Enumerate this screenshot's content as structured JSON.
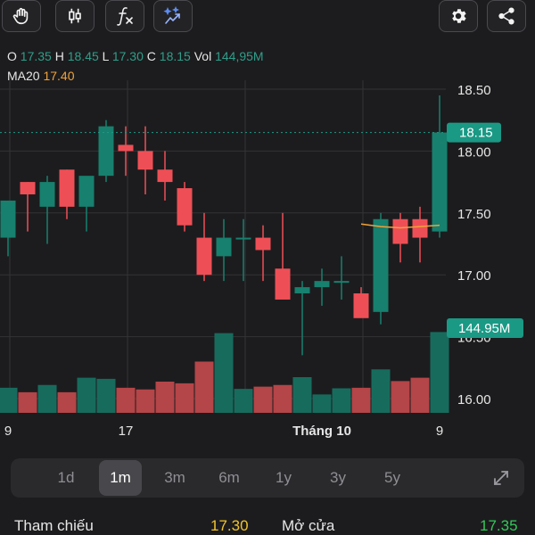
{
  "toolbar": {
    "left_icons": [
      "hand-icon",
      "candlestick-icon",
      "function-icon",
      "magic-icon"
    ],
    "right_icons": [
      "gear-icon",
      "share-icon"
    ]
  },
  "ohlc": {
    "open_label": "O",
    "open": "17.35",
    "high_label": "H",
    "high": "18.45",
    "low_label": "L",
    "low": "17.30",
    "close_label": "C",
    "close": "18.15",
    "vol_label": "Vol",
    "vol": "144,95M"
  },
  "ma": {
    "label": "MA20",
    "value": "17.40"
  },
  "colors": {
    "up": "#17806e",
    "down": "#ee4f56",
    "vol_up": "#176b5d",
    "vol_down": "#b44548",
    "ma": "#f0a23a",
    "grid": "#333336",
    "background": "#1c1c1e"
  },
  "chart_data": {
    "type": "candlestick",
    "y_ticks": [
      "18.50",
      "18.00",
      "17.50",
      "17.00",
      "16.50",
      "16.00"
    ],
    "ylim": [
      16.0,
      18.5
    ],
    "x_tick_labels": [
      {
        "index": 0,
        "label": "9"
      },
      {
        "index": 6,
        "label": "17"
      },
      {
        "index": 16,
        "label": "Tháng 10"
      },
      {
        "index": 22,
        "label": "9"
      }
    ],
    "last_price_label": "18.15",
    "last_price": 18.15,
    "last_volume_label": "144.95M",
    "candles": [
      {
        "o": 17.3,
        "h": 17.55,
        "l": 17.15,
        "c": 17.6
      },
      {
        "o": 17.75,
        "h": 17.75,
        "l": 17.35,
        "c": 17.65
      },
      {
        "o": 17.55,
        "h": 17.8,
        "l": 17.25,
        "c": 17.75
      },
      {
        "o": 17.85,
        "h": 17.85,
        "l": 17.45,
        "c": 17.55
      },
      {
        "o": 17.55,
        "h": 17.7,
        "l": 17.35,
        "c": 17.8
      },
      {
        "o": 17.8,
        "h": 18.25,
        "l": 17.75,
        "c": 18.2
      },
      {
        "o": 18.05,
        "h": 18.2,
        "l": 17.8,
        "c": 18.0
      },
      {
        "o": 18.0,
        "h": 18.2,
        "l": 17.65,
        "c": 17.85
      },
      {
        "o": 17.85,
        "h": 18.0,
        "l": 17.6,
        "c": 17.75
      },
      {
        "o": 17.7,
        "h": 17.75,
        "l": 17.35,
        "c": 17.4
      },
      {
        "o": 17.3,
        "h": 17.5,
        "l": 16.95,
        "c": 17.0
      },
      {
        "o": 17.15,
        "h": 17.45,
        "l": 16.95,
        "c": 17.3
      },
      {
        "o": 17.3,
        "h": 17.45,
        "l": 16.95,
        "c": 17.3
      },
      {
        "o": 17.3,
        "h": 17.4,
        "l": 16.95,
        "c": 17.2
      },
      {
        "o": 17.05,
        "h": 17.5,
        "l": 16.85,
        "c": 16.8
      },
      {
        "o": 16.85,
        "h": 16.95,
        "l": 16.35,
        "c": 16.9
      },
      {
        "o": 16.9,
        "h": 17.05,
        "l": 16.75,
        "c": 16.95
      },
      {
        "o": 16.95,
        "h": 17.15,
        "l": 16.8,
        "c": 16.95
      },
      {
        "o": 16.85,
        "h": 16.9,
        "l": 16.7,
        "c": 16.65
      },
      {
        "o": 16.7,
        "h": 17.5,
        "l": 16.6,
        "c": 17.45
      },
      {
        "o": 17.45,
        "h": 17.5,
        "l": 17.1,
        "c": 17.25
      },
      {
        "o": 17.45,
        "h": 17.55,
        "l": 17.1,
        "c": 17.3
      },
      {
        "o": 17.35,
        "h": 18.45,
        "l": 17.3,
        "c": 18.15
      }
    ],
    "volume_ylim": [
      0,
      160
    ],
    "volumes": [
      45,
      37,
      50,
      37,
      63,
      61,
      45,
      42,
      56,
      53,
      92,
      143,
      43,
      47,
      50,
      64,
      33,
      44,
      45,
      78,
      57,
      63,
      145
    ],
    "ma20": [
      17.41,
      17.39,
      17.38,
      17.39,
      17.4
    ]
  },
  "ranges": [
    "1d",
    "1m",
    "3m",
    "6m",
    "1y",
    "3y",
    "5y"
  ],
  "active_range": "1m",
  "info": {
    "ref_label": "Tham chiếu",
    "ref_value": "17.30",
    "open_label": "Mở cửa",
    "open_value": "17.35"
  }
}
